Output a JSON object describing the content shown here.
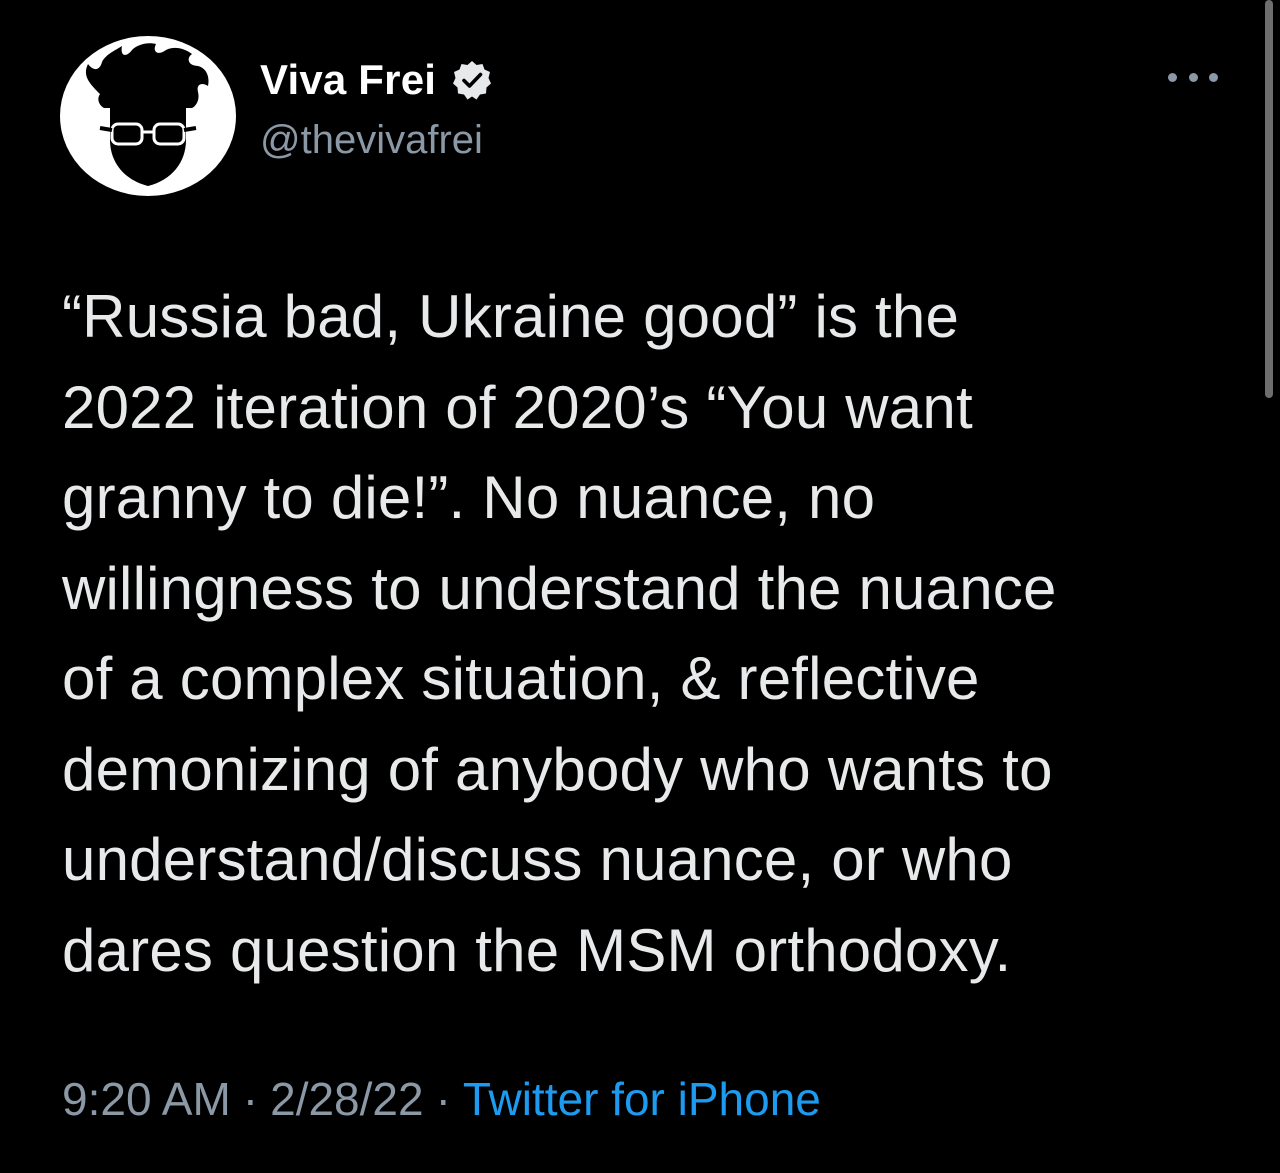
{
  "author": {
    "avatar_icon": "fiery-hair-glasses-avatar-icon",
    "display_name": "Viva Frei",
    "verified_icon": "verified-badge-icon",
    "handle": "@thevivafrei"
  },
  "more_icon": "more-options-icon",
  "tweet": {
    "lines": [
      "“Russia bad, Ukraine good” is the",
      "2022 iteration of 2020’s “You want",
      "granny to die!”. No nuance, no",
      "willingness to understand the nuance",
      "of a complex situation, & reflective",
      "demonizing of anybody who wants to",
      "understand/discuss nuance, or who",
      "dares question the MSM orthodoxy."
    ]
  },
  "meta": {
    "time": "9:20 AM",
    "separator": "·",
    "date": "2/28/22",
    "source": "Twitter for iPhone"
  },
  "colors": {
    "background": "#000000",
    "text_primary": "#e7e9ea",
    "text_secondary": "#8b98a5",
    "link": "#1d9bf0"
  }
}
